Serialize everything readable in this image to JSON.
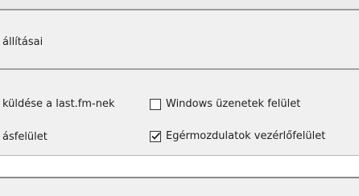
{
  "section": {
    "title": "állításai"
  },
  "options": {
    "left_row1": "küldése a last.fm-nek",
    "left_row2": "ásfelület",
    "right_row1": {
      "label": "Windows üzenetek felület",
      "checked": false
    },
    "right_row2": {
      "label": "Egérmozdulatok vezérlőfelület",
      "checked": true
    }
  },
  "icons": {
    "checkmark": "check-icon"
  },
  "colors": {
    "background": "#f0f0f0",
    "field": "#ffffff",
    "separator": "#a3a3a3"
  }
}
